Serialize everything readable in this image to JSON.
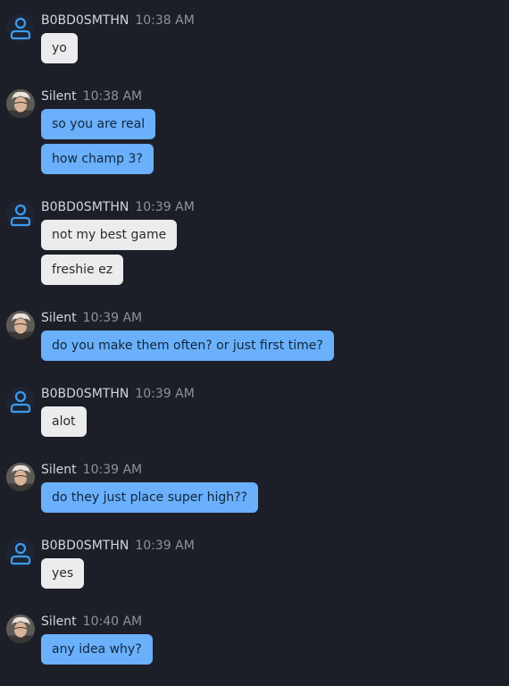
{
  "colors": {
    "background": "#1d1f28",
    "bubble_other": "#ececee",
    "bubble_self": "#6ab0fb",
    "default_avatar_icon": "#3d9cf0"
  },
  "users": {
    "other": {
      "name": "B0BD0SMTHN",
      "avatar_icon": "person-icon"
    },
    "self": {
      "name": "Silent",
      "avatar_icon": "profile-photo"
    }
  },
  "messages": [
    {
      "user": "B0BD0SMTHN",
      "time": "10:38 AM",
      "lines": [
        "yo"
      ]
    },
    {
      "user": "Silent",
      "time": "10:38 AM",
      "lines": [
        "so you are real",
        "how champ 3?"
      ]
    },
    {
      "user": "B0BD0SMTHN",
      "time": "10:39 AM",
      "lines": [
        "not my best game",
        "freshie ez"
      ]
    },
    {
      "user": "Silent",
      "time": "10:39 AM",
      "lines": [
        "do you make them often? or just first time?"
      ]
    },
    {
      "user": "B0BD0SMTHN",
      "time": "10:39 AM",
      "lines": [
        "alot"
      ]
    },
    {
      "user": "Silent",
      "time": "10:39 AM",
      "lines": [
        "do they just place super high??"
      ]
    },
    {
      "user": "B0BD0SMTHN",
      "time": "10:39 AM",
      "lines": [
        "yes"
      ]
    },
    {
      "user": "Silent",
      "time": "10:40 AM",
      "lines": [
        "any idea why?"
      ]
    }
  ]
}
